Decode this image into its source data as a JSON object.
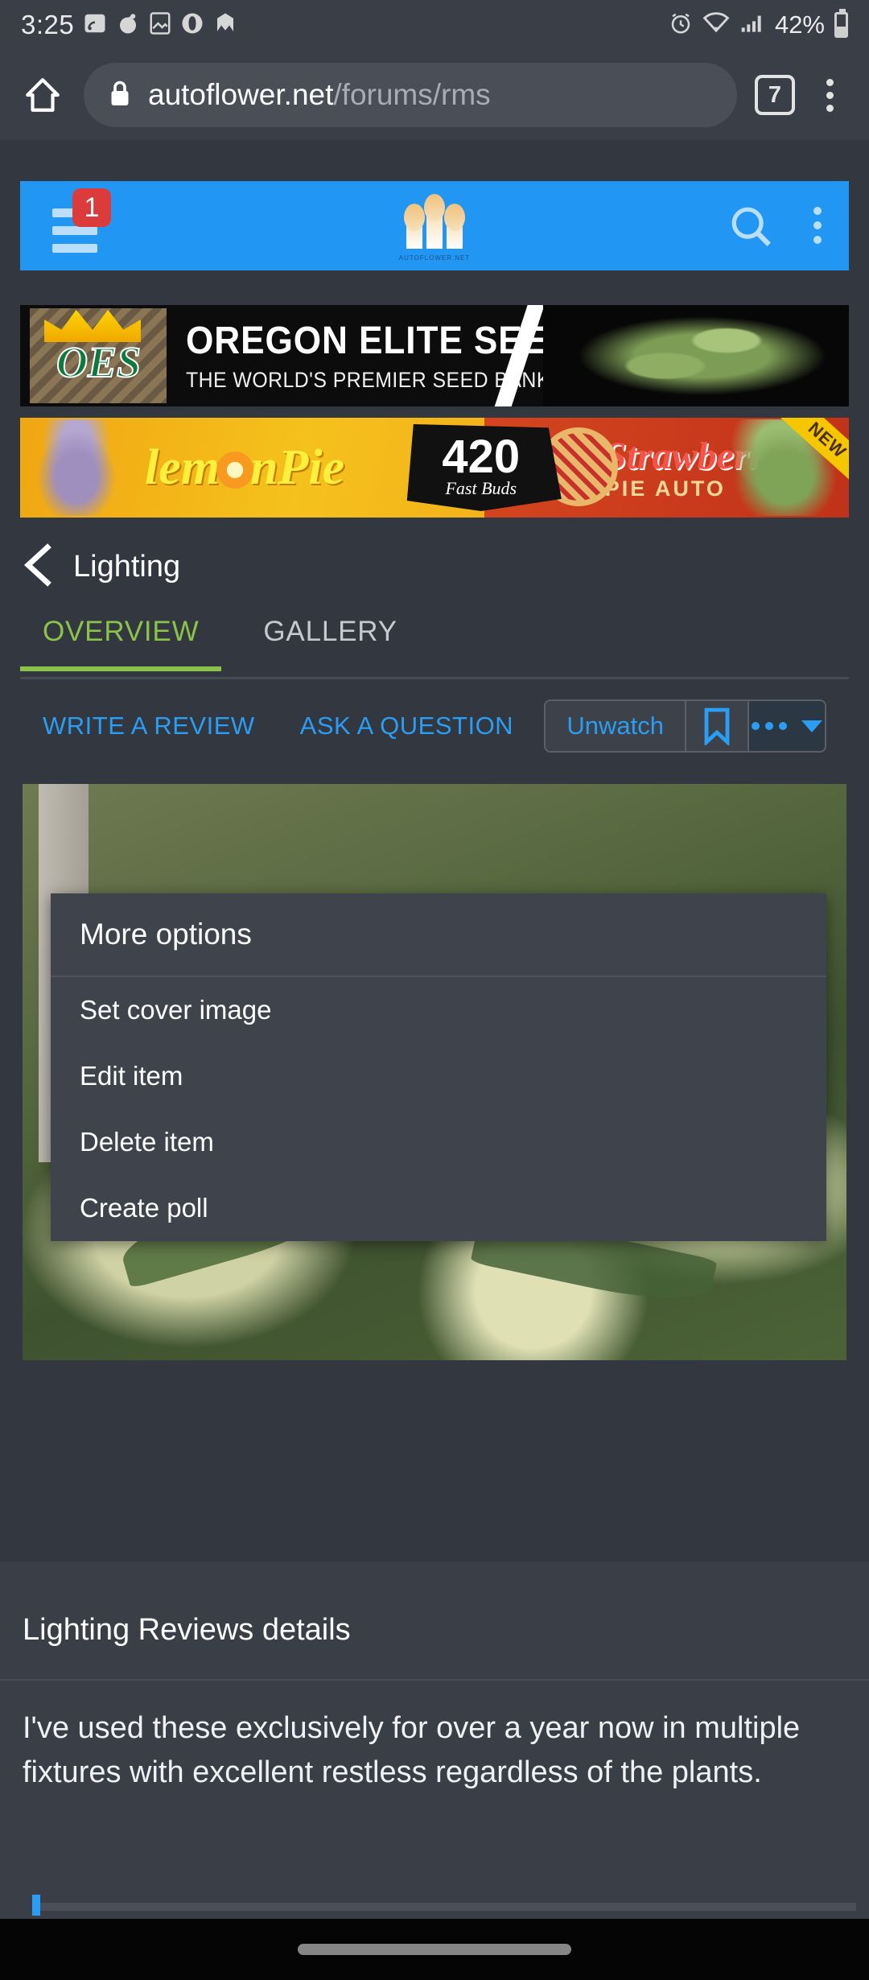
{
  "status_bar": {
    "time": "3:25",
    "battery_percent": "42%",
    "icons": [
      "cast-icon",
      "reddit-icon",
      "gallery-icon",
      "opera-icon",
      "malwarebytes-icon",
      "alarm-icon",
      "wifi-icon",
      "signal-icon",
      "battery-icon"
    ]
  },
  "browser": {
    "home_icon": "home-icon",
    "lock_icon": "lock-icon",
    "url_domain": "autoflower.net",
    "url_path": "/forums/rms",
    "tab_count": "7",
    "menu_icon": "overflow-menu-icon"
  },
  "site_header": {
    "menu_badge": "1",
    "hamburger_icon": "hamburger-icon",
    "logo_caption": "AUTOFLOWER.NET",
    "search_icon": "search-icon",
    "overflow_icon": "overflow-menu-icon",
    "accent_color": "#2196f3"
  },
  "ads": {
    "banner_one": {
      "brand_mark": "OES",
      "title": "OREGON ELITE SEEDS",
      "subtitle": "THE WORLD'S PREMIER SEED BANK"
    },
    "banner_two": {
      "left_product": "lem nPie",
      "logo_number": "420",
      "logo_brand": "Fast Buds",
      "right_product": "Strawberry",
      "right_product_sub": "PIE AUTO",
      "ribbon": "NEW"
    }
  },
  "breadcrumb": {
    "back_icon": "back-chevron-icon",
    "label": "Lighting"
  },
  "tabs": [
    {
      "label": "OVERVIEW",
      "active": true
    },
    {
      "label": "GALLERY",
      "active": false
    }
  ],
  "actions": {
    "write_review": "WRITE A REVIEW",
    "ask_question": "ASK A QUESTION",
    "watch_label": "Unwatch",
    "bookmark_icon": "bookmark-icon",
    "more_icon": "more-dropdown-icon",
    "link_color": "#2a9df4"
  },
  "dropdown": {
    "title": "More options",
    "items": [
      "Set cover image",
      "Edit item",
      "Delete item",
      "Create poll"
    ]
  },
  "hero": {
    "alt": "cannabis-plants-photo"
  },
  "details": {
    "heading": "Lighting Reviews details",
    "body": "I've used these exclusively for over a year now in multiple fixtures with excellent restless regardless of the plants."
  },
  "nav_bar": {
    "gesture_pill": "home-gesture-pill"
  }
}
